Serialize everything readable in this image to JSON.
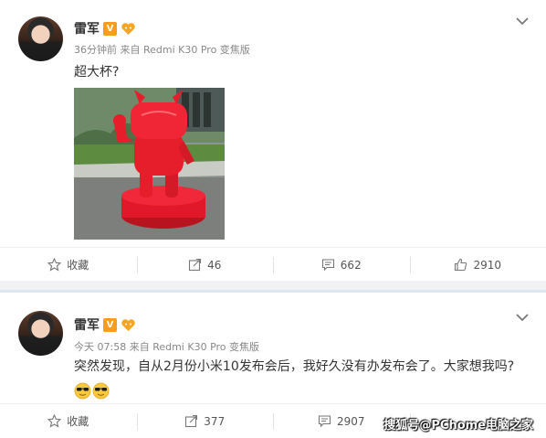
{
  "posts": [
    {
      "username": "雷军",
      "v_badge": "V",
      "meta": "36分钟前 来自 Redmi K30 Pro 变焦版",
      "content": "超大杯?",
      "actions": {
        "favorite": "收藏",
        "repost": "46",
        "comment": "662",
        "like": "2910"
      }
    },
    {
      "username": "雷军",
      "v_badge": "V",
      "meta": "今天 07:58 来自 Redmi K30 Pro 变焦版",
      "content": "突然发现，自从2月份小米10发布会后，我好久没有办发布会了。大家想我吗?",
      "actions": {
        "favorite": "收藏",
        "repost": "377",
        "comment": "2907"
      }
    }
  ],
  "watermark": "搜狐号@PChome电脑之家",
  "colors": {
    "accent_orange": "#f99d1c",
    "mascot_red": "#e61e2b",
    "separator_blue": "#dbe8f3"
  },
  "icons": [
    "chevron-down-icon",
    "star-icon",
    "repost-icon",
    "comment-icon",
    "thumbs-up-icon",
    "sunglasses-emoji-icon"
  ]
}
